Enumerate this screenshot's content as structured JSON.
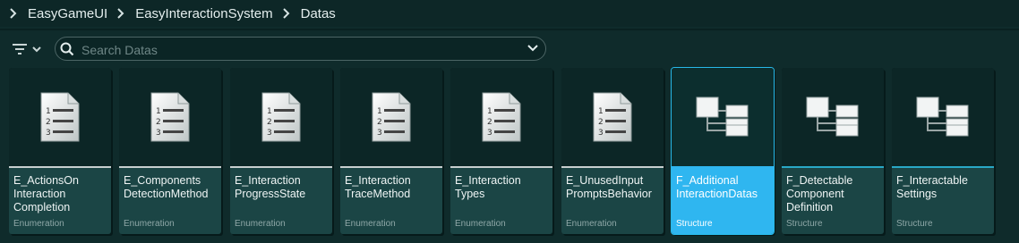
{
  "breadcrumb": {
    "items": [
      "EasyGameUI",
      "EasyInteractionSystem",
      "Datas"
    ]
  },
  "search": {
    "placeholder": "Search Datas",
    "value": ""
  },
  "assets": [
    {
      "name": "E_ActionsOn\nInteraction\nCompletion",
      "type": "Enumeration",
      "icon": "enumeration-icon",
      "selected": false
    },
    {
      "name": "E_Components\nDetectionMethod",
      "type": "Enumeration",
      "icon": "enumeration-icon",
      "selected": false
    },
    {
      "name": "E_Interaction\nProgressState",
      "type": "Enumeration",
      "icon": "enumeration-icon",
      "selected": false
    },
    {
      "name": "E_Interaction\nTraceMethod",
      "type": "Enumeration",
      "icon": "enumeration-icon",
      "selected": false
    },
    {
      "name": "E_Interaction\nTypes",
      "type": "Enumeration",
      "icon": "enumeration-icon",
      "selected": false
    },
    {
      "name": "E_UnusedInput\nPromptsBehavior",
      "type": "Enumeration",
      "icon": "enumeration-icon",
      "selected": false
    },
    {
      "name": "F_Additional\nInteractionDatas",
      "type": "Structure",
      "icon": "structure-icon",
      "selected": true
    },
    {
      "name": "F_Detectable\nComponent\nDefinition",
      "type": "Structure",
      "icon": "structure-icon",
      "selected": false
    },
    {
      "name": "F_Interactable\nSettings",
      "type": "Structure",
      "icon": "structure-icon",
      "selected": false
    }
  ],
  "colors": {
    "background": "#0f2b2b",
    "selection": "#2fb6f0",
    "structure_accent": "#29a8c6",
    "enumeration_accent": "#c8cfcf"
  }
}
